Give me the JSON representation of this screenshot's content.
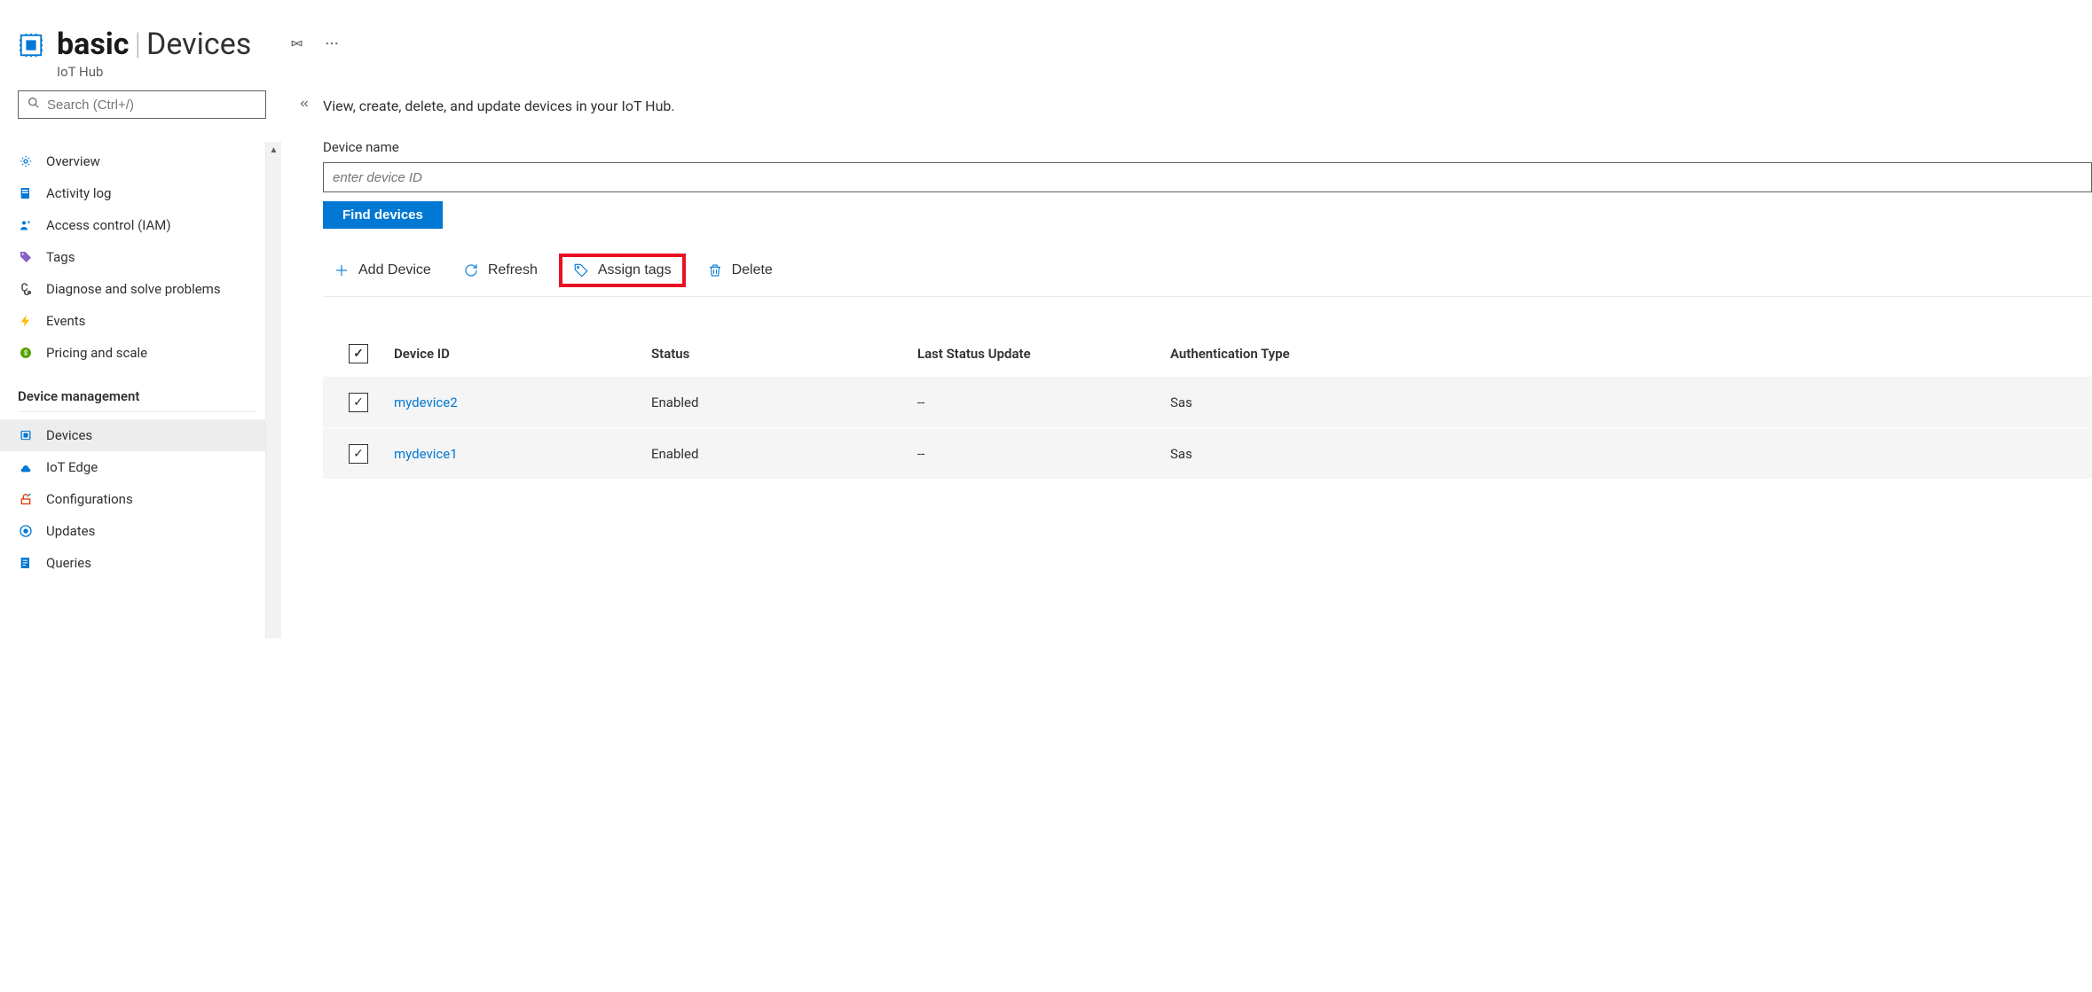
{
  "header": {
    "resource_name": "basic",
    "separator": "|",
    "page_title": "Devices",
    "service_label": "IoT Hub"
  },
  "sidebar": {
    "search_placeholder": "Search (Ctrl+/)",
    "items": [
      {
        "label": "Overview",
        "icon": "overview"
      },
      {
        "label": "Activity log",
        "icon": "activity"
      },
      {
        "label": "Access control (IAM)",
        "icon": "access"
      },
      {
        "label": "Tags",
        "icon": "tags"
      },
      {
        "label": "Diagnose and solve problems",
        "icon": "diagnose"
      },
      {
        "label": "Events",
        "icon": "events"
      },
      {
        "label": "Pricing and scale",
        "icon": "pricing"
      }
    ],
    "section_label": "Device management",
    "mgmt_items": [
      {
        "label": "Devices",
        "icon": "devices",
        "active": true
      },
      {
        "label": "IoT Edge",
        "icon": "edge"
      },
      {
        "label": "Configurations",
        "icon": "configs"
      },
      {
        "label": "Updates",
        "icon": "updates"
      },
      {
        "label": "Queries",
        "icon": "queries"
      }
    ]
  },
  "main": {
    "description": "View, create, delete, and update devices in your IoT Hub.",
    "device_name_label": "Device name",
    "device_name_placeholder": "enter device ID",
    "find_button": "Find devices",
    "toolbar": {
      "add": "Add Device",
      "refresh": "Refresh",
      "assign_tags": "Assign tags",
      "delete": "Delete"
    },
    "table": {
      "columns": [
        "Device ID",
        "Status",
        "Last Status Update",
        "Authentication Type"
      ],
      "rows": [
        {
          "device_id": "mydevice2",
          "status": "Enabled",
          "last_update": "--",
          "auth": "Sas",
          "checked": true
        },
        {
          "device_id": "mydevice1",
          "status": "Enabled",
          "last_update": "--",
          "auth": "Sas",
          "checked": true
        }
      ]
    }
  }
}
